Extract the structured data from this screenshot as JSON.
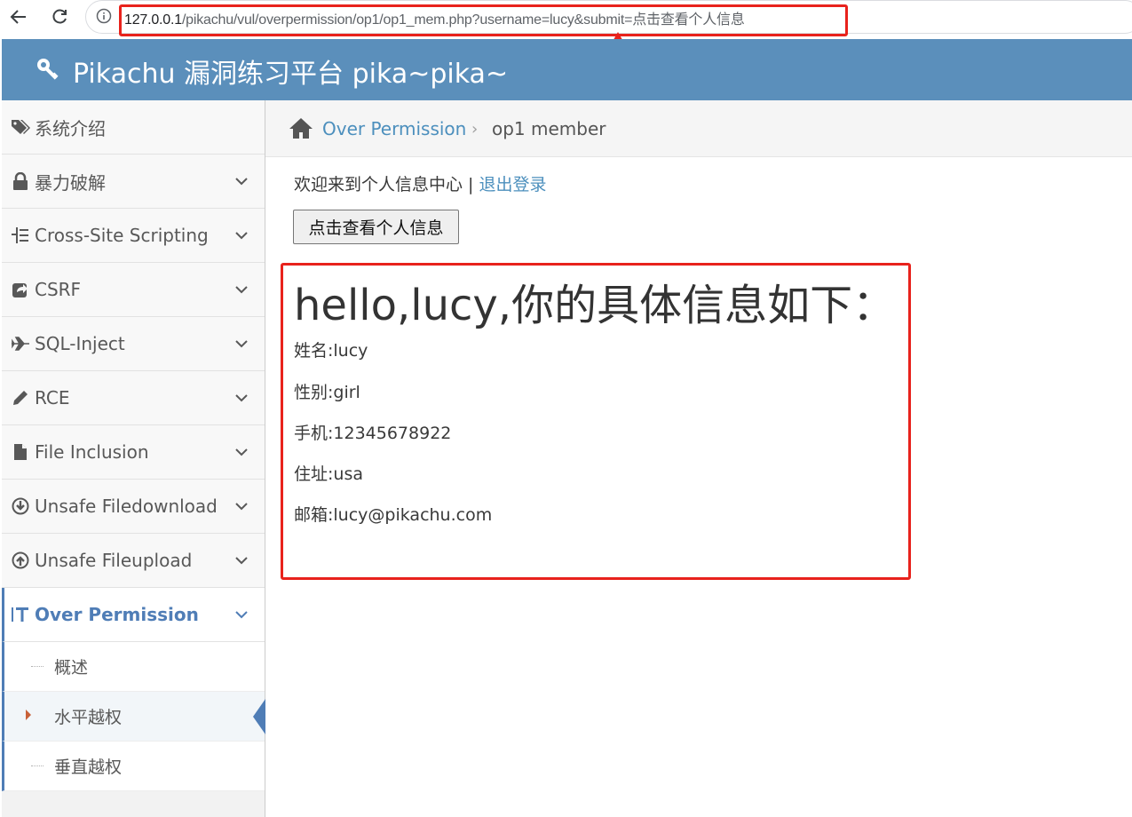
{
  "browser": {
    "url_host": "127.0.0.1",
    "url_path": "/pikachu/vul/overpermission/op1/op1_mem.php?username=lucy&submit=点击查看个人信息"
  },
  "header": {
    "title": "Pikachu 漏洞练习平台 pika~pika~"
  },
  "sidebar": {
    "items": [
      {
        "label": "系统介绍",
        "icon": "tags-icon"
      },
      {
        "label": "暴力破解",
        "icon": "lock-icon"
      },
      {
        "label": "Cross-Site Scripting",
        "icon": "list-icon"
      },
      {
        "label": "CSRF",
        "icon": "share-icon"
      },
      {
        "label": "SQL-Inject",
        "icon": "plane-icon"
      },
      {
        "label": "RCE",
        "icon": "pencil-icon"
      },
      {
        "label": "File Inclusion",
        "icon": "file-icon"
      },
      {
        "label": "Unsafe Filedownload",
        "icon": "download-icon"
      },
      {
        "label": "Unsafe Fileupload",
        "icon": "upload-icon"
      },
      {
        "label": "Over Permission",
        "icon": "text-height-icon"
      }
    ],
    "subitems": [
      {
        "label": "概述"
      },
      {
        "label": "水平越权"
      },
      {
        "label": "垂直越权"
      }
    ]
  },
  "breadcrumb": {
    "section": "Over Permission",
    "page": "op1 member"
  },
  "main": {
    "welcome_text": "欢迎来到个人信息中心 | ",
    "logout_label": "退出登录",
    "view_button": "点击查看个人信息",
    "greeting": "hello,lucy,你的具体信息如下：",
    "info": [
      "姓名:lucy",
      "性别:girl",
      "手机:12345678922",
      "住址:usa",
      "邮箱:lucy@pikachu.com"
    ]
  },
  "colors": {
    "header": "#5b8fbb",
    "accent": "#4f7db6",
    "annotation": "#e8221c"
  }
}
